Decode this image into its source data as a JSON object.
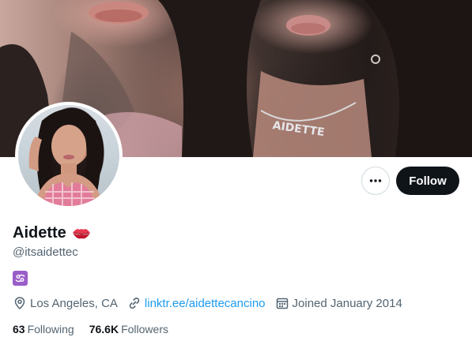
{
  "profile": {
    "display_name": "Aidette",
    "handle": "@itsaidettec",
    "name_emoji_icon": "kissing-lips-icon",
    "zodiac_icon": "cancer-zodiac-icon",
    "location": "Los Angeles, CA",
    "website": "linktr.ee/aidettecancino",
    "joined": "Joined January 2014",
    "following_count": "63",
    "following_label": "Following",
    "followers_count": "76.6K",
    "followers_label": "Followers",
    "banner_necklace_text": "AIDETTE"
  },
  "actions": {
    "more_icon": "more-horizontal-icon",
    "follow_label": "Follow"
  },
  "colors": {
    "text_primary": "#0f1419",
    "text_secondary": "#536471",
    "link": "#1d9bf0",
    "follow_button_bg": "#0f1419",
    "zodiac_badge_bg": "#9a5ec8",
    "border": "#cfd9de"
  }
}
